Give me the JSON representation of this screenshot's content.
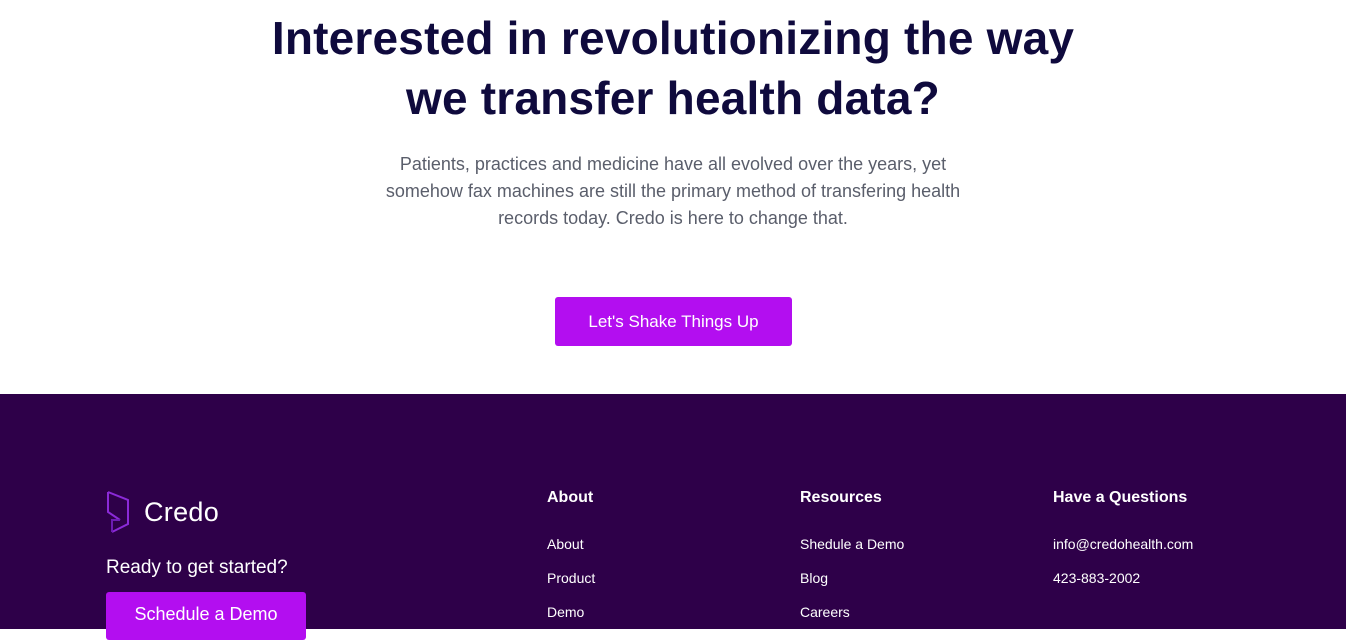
{
  "hero": {
    "title_line1": "Interested in revolutionizing the way",
    "title_line2": "we transfer health data?",
    "subtitle_line1": "Patients, practices and medicine have all evolved over the years, yet",
    "subtitle_line2": "somehow fax machines are still the primary method of transfering health",
    "subtitle_line3": "records today. Credo is here to change that.",
    "cta_label": "Let's Shake Things Up"
  },
  "footer": {
    "brand_name": "Credo",
    "ready_text": "Ready to get started?",
    "schedule_label": "Schedule a Demo",
    "about": {
      "heading": "About",
      "links": [
        "About",
        "Product",
        "Demo"
      ]
    },
    "resources": {
      "heading": "Resources",
      "links": [
        "Shedule a Demo",
        "Blog",
        "Careers"
      ]
    },
    "contact": {
      "heading": "Have a Questions",
      "email": "info@credohealth.com",
      "phone": "423-883-2002"
    }
  },
  "colors": {
    "accent": "#b30ef0",
    "footer_bg": "#2e0049",
    "title": "#0f0a3d",
    "body_text": "#5a5e6b"
  },
  "icons": {
    "brand_logo": "credo-logo-icon"
  }
}
